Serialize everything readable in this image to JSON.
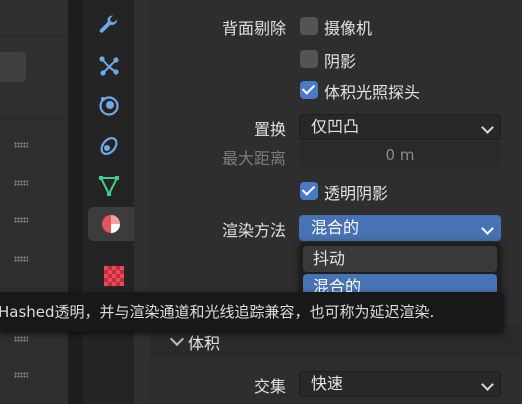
{
  "properties": {
    "backface_culling_label": "背面剔除",
    "camera_label": "摄像机",
    "camera_checked": false,
    "shadow_label": "阴影",
    "shadow_checked": false,
    "light_probe_volume_label": "体积光照探头",
    "light_probe_volume_checked": true,
    "displacement_label": "置换",
    "displacement_value": "仅凹凸",
    "max_distance_label": "最大距离",
    "max_distance_value": "0 m",
    "transparent_shadow_label": "透明阴影",
    "transparent_shadow_checked": true,
    "render_method_label": "渲染方法",
    "render_method_value": "混合的",
    "volume_section_title": "体积",
    "intersection_label": "交集",
    "intersection_value": "快速"
  },
  "dropdown_menu": {
    "options": [
      "抖动",
      "混合的"
    ],
    "selected": "混合的"
  },
  "tooltip": {
    "text": "Hashed透明，并与渲染通道和光线追踪兼容，也可称为延迟渲染."
  },
  "colors": {
    "accent": "#4772b3",
    "checkbox_on": "#4a79c8"
  },
  "tabs": [
    "wrench-icon",
    "particles-icon",
    "physics-icon",
    "constraints-icon",
    "data-icon",
    "material-icon",
    "texture-icon"
  ]
}
